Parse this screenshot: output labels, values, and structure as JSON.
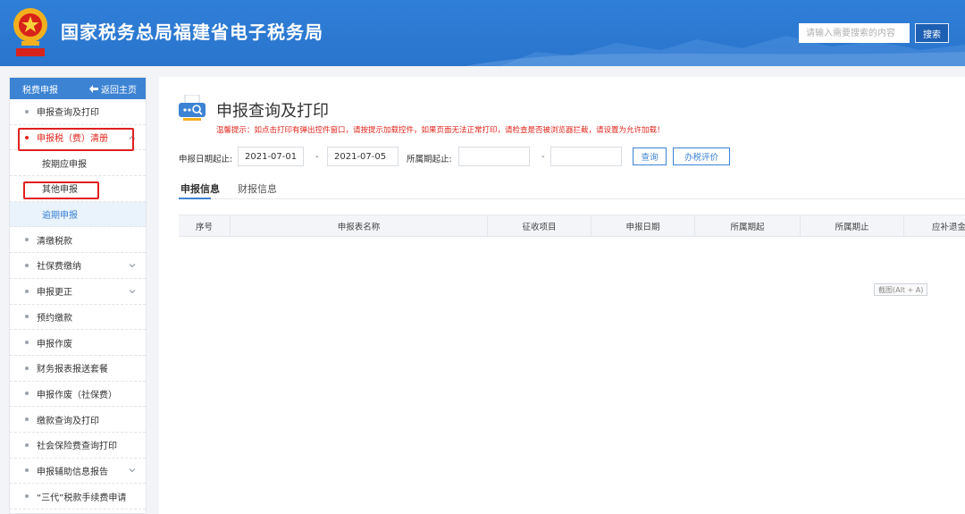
{
  "header": {
    "site_title": "国家税务总局福建省电子税务局",
    "search_placeholder": "请输入需要搜索的内容",
    "search_button": "搜索"
  },
  "sidebar": {
    "head_label": "税费申报",
    "back_label": "返回主页",
    "items_top": [
      {
        "label": "申报查询及打印"
      }
    ],
    "expanded": {
      "label": "申报税（费）清册"
    },
    "sub_items": [
      {
        "label": "按期应申报"
      },
      {
        "label": "其他申报"
      },
      {
        "label": "逾期申报"
      }
    ],
    "items_bottom": [
      {
        "label": "清缴税款",
        "chevron": false
      },
      {
        "label": "社保费缴纳",
        "chevron": true
      },
      {
        "label": "申报更正",
        "chevron": true
      },
      {
        "label": "预约缴款",
        "chevron": false
      },
      {
        "label": "申报作废",
        "chevron": false
      },
      {
        "label": "财务报表报送套餐",
        "chevron": false
      },
      {
        "label": "申报作废（社保费）",
        "chevron": false
      },
      {
        "label": "缴款查询及打印",
        "chevron": false
      },
      {
        "label": "社会保险费查询打印",
        "chevron": false
      },
      {
        "label": "申报辅助信息报告",
        "chevron": true
      },
      {
        "label": "“三代”税款手续费申请",
        "chevron": false
      }
    ]
  },
  "main": {
    "title": "申报查询及打印",
    "warning": "温馨提示：如点击打印有弹出控件窗口，请按提示加载控件，如果页面无法正常打印，请检查是否被浏览器拦截，请设置为允许加载！",
    "filters": {
      "date_label": "申报日期起止:",
      "date_from": "2021-07-01",
      "date_to": "2021-07-05",
      "dash": "-",
      "period_label": "所属期起止:",
      "period_from": "",
      "period_to": "",
      "query_button": "查询",
      "rate_button": "办税评价"
    },
    "tabs": [
      {
        "label": "申报信息"
      },
      {
        "label": "财报信息"
      }
    ],
    "table": {
      "columns": [
        "序号",
        "申报表名称",
        "征收项目",
        "申报日期",
        "所属期起",
        "所属期止",
        "应补退金"
      ]
    },
    "tooltip": "截图(Alt + A)"
  }
}
